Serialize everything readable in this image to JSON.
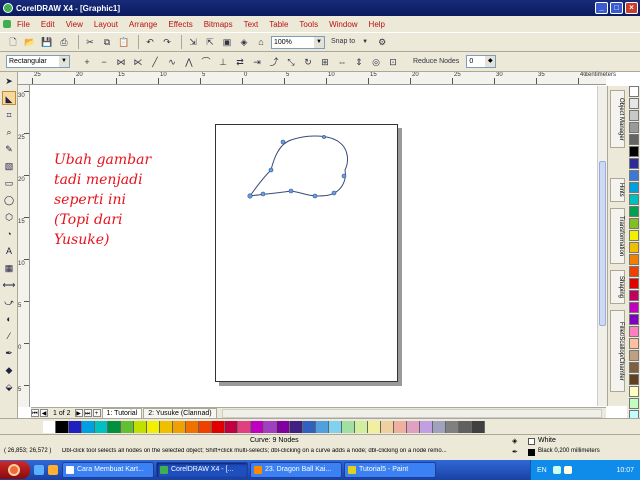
{
  "window": {
    "title": "CorelDRAW X4 - [Graphic1]"
  },
  "menu": [
    "File",
    "Edit",
    "View",
    "Layout",
    "Arrange",
    "Effects",
    "Bitmaps",
    "Text",
    "Table",
    "Tools",
    "Window",
    "Help"
  ],
  "toolbar": {
    "zoom": "100%",
    "snap_label": "Snap to"
  },
  "property_bar": {
    "shape_type": "Rectangular",
    "reduce_nodes_label": "Reduce Nodes",
    "reduce_nodes_value": "0"
  },
  "ruler": {
    "top_labels": [
      "25",
      "20",
      "15",
      "10",
      "5",
      "0",
      "5",
      "10",
      "15",
      "20",
      "25",
      "30",
      "35",
      "40"
    ],
    "left_labels": [
      "30",
      "25",
      "20",
      "15",
      "10",
      "5",
      "0",
      "5"
    ],
    "unit": "centimeters"
  },
  "canvas": {
    "instruction_lines": [
      "Ubah gambar",
      "tadi menjadi",
      "seperti ini",
      "(Topi dari",
      "Yusuke)"
    ]
  },
  "dockers": [
    "Object Manager",
    "Hints",
    "Transformation",
    "Shaping",
    "Fillet/Scallop/Chamfer"
  ],
  "doc_nav": {
    "page_indicator": "1 of 2",
    "tabs": [
      "1: Tutorial",
      "2: Yusuke (Clannad)"
    ]
  },
  "colors": {
    "vertical_palette": [
      "#ffffff",
      "#e6e6e6",
      "#c8c8c8",
      "#9a9a9a",
      "#646464",
      "#000000",
      "#2b2b9a",
      "#3c78d8",
      "#00a0e0",
      "#00c0c0",
      "#00a050",
      "#80c020",
      "#f0f000",
      "#f0c000",
      "#f08000",
      "#f04000",
      "#e00000",
      "#c00060",
      "#c000c0",
      "#8000c0",
      "#ff80c0",
      "#ffc0a0",
      "#c0a080",
      "#806040",
      "#604020",
      "#ffffc0",
      "#c0ffc0",
      "#c0ffff",
      "#c0c0ff"
    ],
    "horizontal_palette": [
      "#ffffff",
      "#000000",
      "#2020c0",
      "#00a0e0",
      "#00c0c0",
      "#009040",
      "#60c030",
      "#c0e000",
      "#f0f000",
      "#f0c000",
      "#f0a000",
      "#f07000",
      "#f04000",
      "#e00000",
      "#c00040",
      "#e04080",
      "#c000c0",
      "#a040c0",
      "#8000a0",
      "#402080",
      "#3060c0",
      "#50a0e0",
      "#80d0f0",
      "#a0e0a0",
      "#d0f0a0",
      "#f0f0a0",
      "#f0d0a0",
      "#f0b0a0",
      "#e0a0c0",
      "#c0a0e0",
      "#a0a0c0",
      "#808080",
      "#606060",
      "#404040"
    ]
  },
  "status": {
    "curve_info": "Curve: 9 Nodes",
    "coords": "( 26,853; 26,572 )",
    "hint": "Dbl-click tool selects all nodes on the selected object; Shift+click multi-selects; dbl-clicking on a curve adds a node; dbl-clicking on a node remo...",
    "fill_label": "White",
    "outline_label": "Black  0,200 millimeters"
  },
  "taskbar": {
    "items": [
      "Cara Membuat Kart...",
      "CorelDRAW X4 - [...",
      "23. Dragon Ball Kai...",
      "Tutorial5 - Paint"
    ],
    "language": "EN",
    "clock": "10:07"
  }
}
